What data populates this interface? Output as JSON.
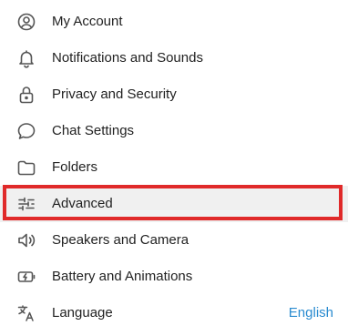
{
  "settings_menu": {
    "items": [
      {
        "label": "My Account",
        "icon": "user-circle-icon"
      },
      {
        "label": "Notifications and Sounds",
        "icon": "bell-icon"
      },
      {
        "label": "Privacy and Security",
        "icon": "lock-icon"
      },
      {
        "label": "Chat Settings",
        "icon": "chat-bubble-icon"
      },
      {
        "label": "Folders",
        "icon": "folder-icon"
      },
      {
        "label": "Advanced",
        "icon": "sliders-icon"
      },
      {
        "label": "Speakers and Camera",
        "icon": "speaker-icon"
      },
      {
        "label": "Battery and Animations",
        "icon": "battery-icon"
      },
      {
        "label": "Language",
        "icon": "translate-icon",
        "value": "English"
      }
    ],
    "highlighted_item": "Advanced"
  },
  "colors": {
    "text": "#222222",
    "icon": "#555555",
    "value_link": "#2a8bd0",
    "highlight_background": "#f0f0f0",
    "highlight_border": "#e02a2a"
  }
}
